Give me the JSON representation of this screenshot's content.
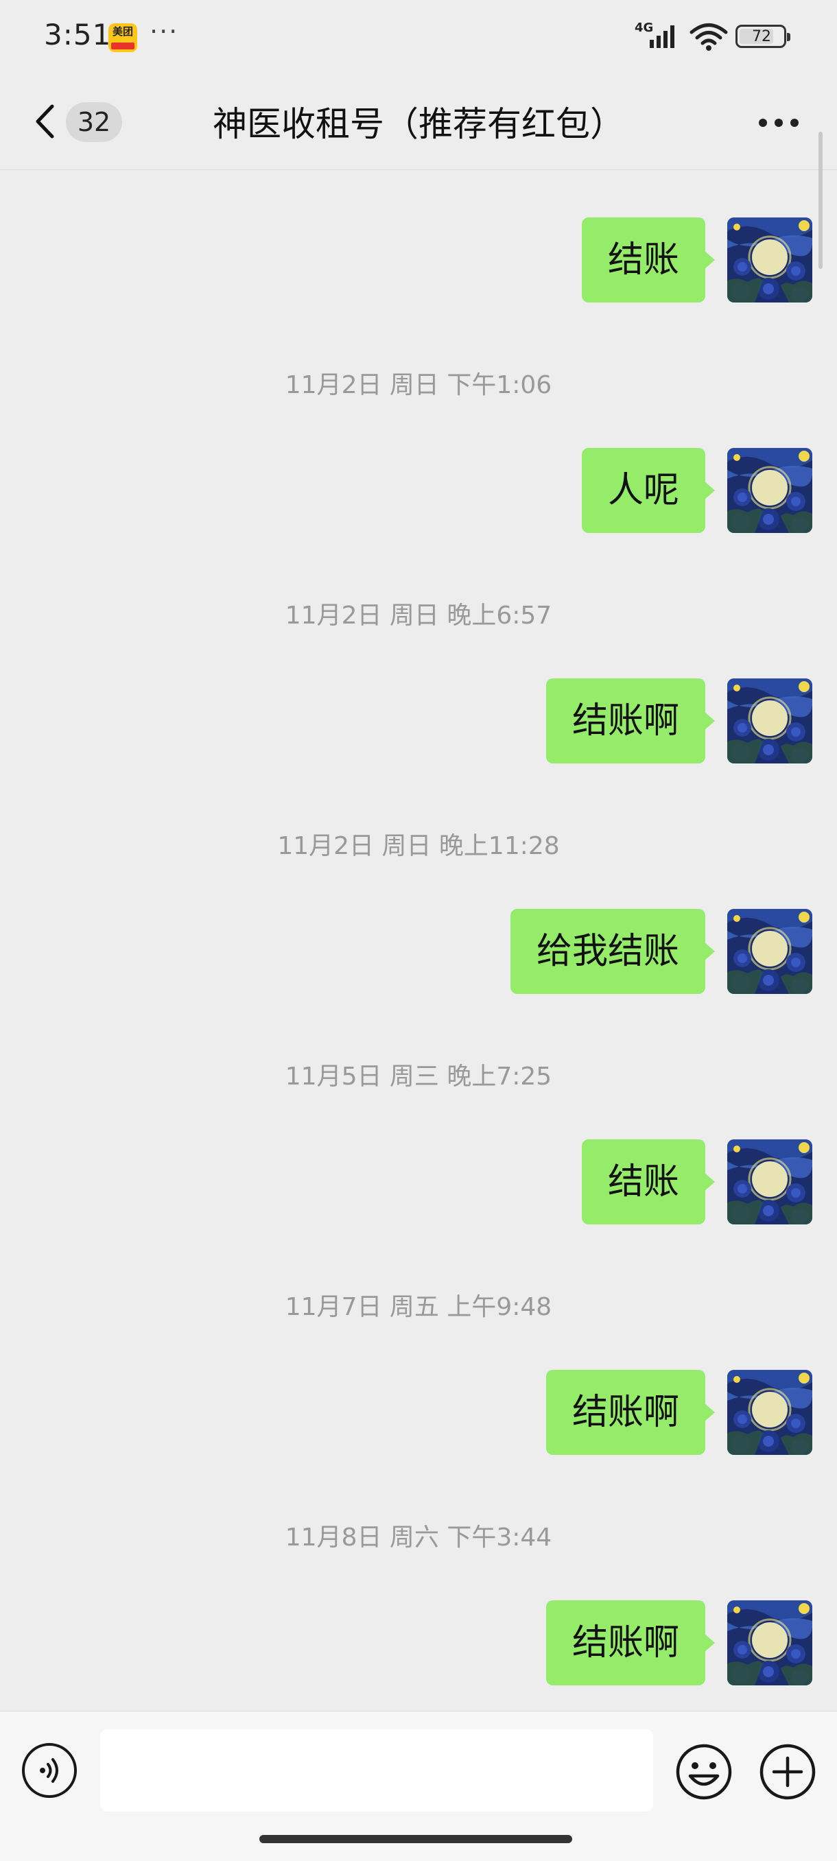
{
  "status_bar": {
    "time": "3:51",
    "app_notification_icon": "meituan-icon",
    "app_notification_text": "美团",
    "overflow": "···",
    "network": "4G",
    "battery": "72"
  },
  "nav": {
    "back_icon": "chevron-left-icon",
    "unread_count": "32",
    "title": "神医收租号（推荐有红包）",
    "more_icon": "more-horizontal-icon"
  },
  "messages": [
    {
      "type": "sent",
      "text": "结账"
    },
    {
      "type": "time",
      "text": "11月2日 周日 下午1:06"
    },
    {
      "type": "sent",
      "text": "人呢"
    },
    {
      "type": "time",
      "text": "11月2日 周日 晚上6:57"
    },
    {
      "type": "sent",
      "text": "结账啊"
    },
    {
      "type": "time",
      "text": "11月2日 周日 晚上11:28"
    },
    {
      "type": "sent",
      "text": "给我结账"
    },
    {
      "type": "time",
      "text": "11月5日 周三 晚上7:25"
    },
    {
      "type": "sent",
      "text": "结账"
    },
    {
      "type": "time",
      "text": "11月7日 周五 上午9:48"
    },
    {
      "type": "sent",
      "text": "结账啊"
    },
    {
      "type": "time",
      "text": "11月8日 周六 下午3:44"
    },
    {
      "type": "sent",
      "text": "结账啊"
    }
  ],
  "input_bar": {
    "voice_icon": "voice-icon",
    "input_value": "",
    "emoji_icon": "emoji-icon",
    "plus_icon": "plus-circle-icon"
  },
  "colors": {
    "background": "#ededed",
    "sent_bubble": "#95ec69",
    "timestamp_text": "#999999"
  }
}
